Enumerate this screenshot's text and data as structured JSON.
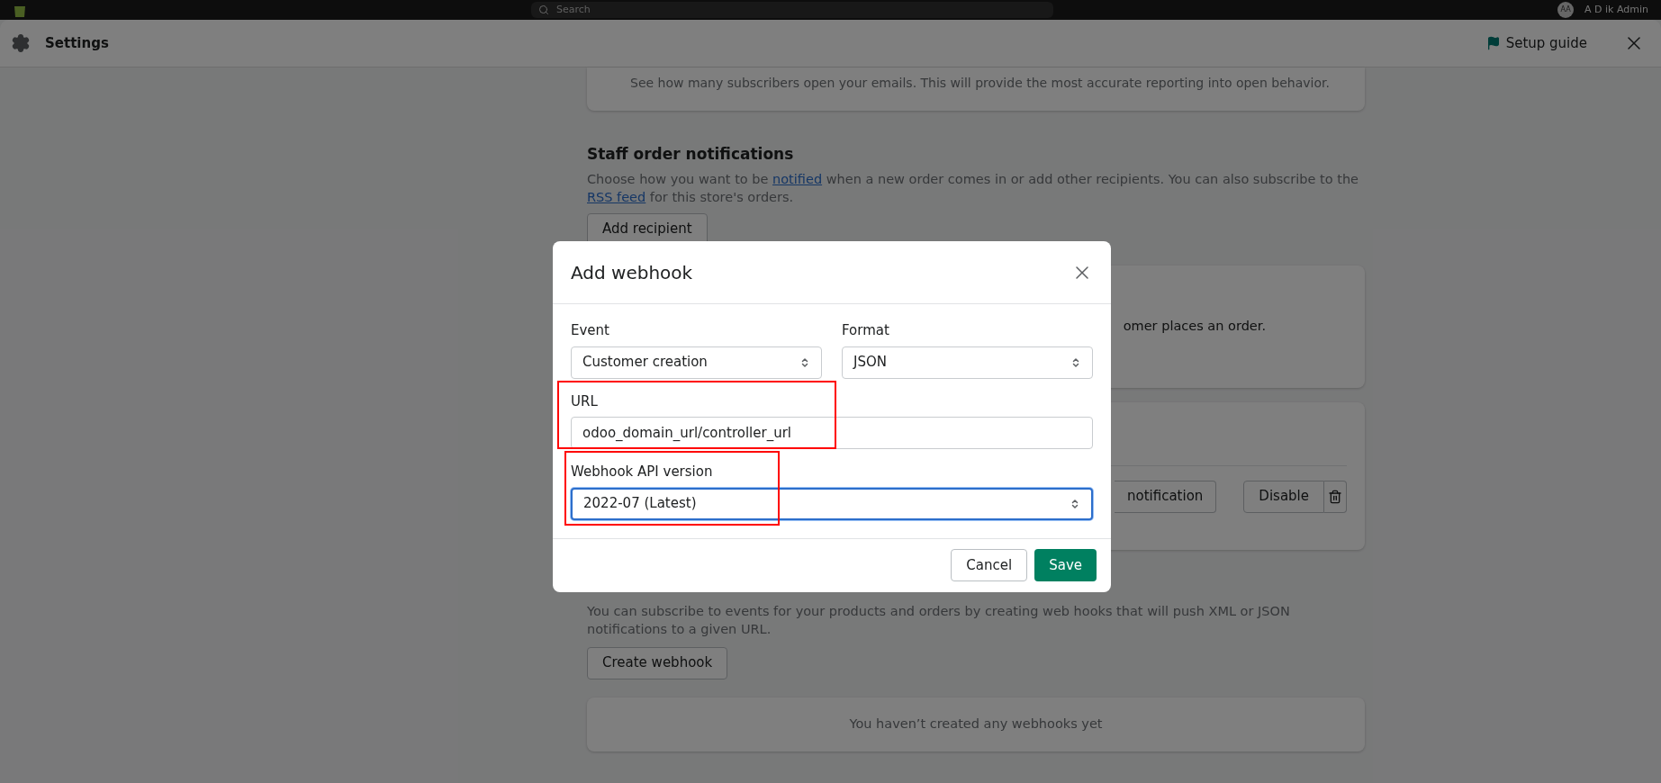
{
  "top_bar": {
    "search": {
      "placeholder": "Search"
    },
    "avatar": "AA",
    "user": "A D ik Admin"
  },
  "header": {
    "title": "Settings",
    "setup_guide": "Setup guide"
  },
  "open_tracking": {
    "description": "See how many subscribers open your emails. This will provide the most accurate reporting into open behavior."
  },
  "staff_notifications": {
    "title": "Staff order notifications",
    "text": [
      {
        "kind": "text",
        "text": "Choose how you want to be "
      },
      {
        "kind": "link",
        "text": "notified"
      },
      {
        "kind": "text",
        "text": " when a new order comes in or add other recipients. You can also subscribe to the "
      },
      {
        "kind": "link",
        "text": "RSS feed"
      },
      {
        "kind": "text",
        "text": " for this store's orders."
      }
    ],
    "button": "Add recipient"
  },
  "order_card": {
    "text": "omer places an order."
  },
  "recipient_card": {
    "buttons": [
      "notification",
      "Disable"
    ]
  },
  "webhooks": {
    "description": "You can subscribe to events for your products and orders by creating web hooks that will push XML or JSON notifications to a given URL.",
    "button": "Create webhook",
    "empty": "You haven’t created any webhooks yet"
  },
  "modal": {
    "title": "Add webhook",
    "fields": [
      {
        "kind": "select",
        "label": "Event",
        "value": "Customer creation",
        "focused": false,
        "highlighted": false
      },
      {
        "kind": "select",
        "label": "Format",
        "value": "JSON",
        "focused": false,
        "highlighted": false
      },
      {
        "kind": "input",
        "label": "URL",
        "value": "odoo_domain_url/controller_url",
        "focused": false,
        "highlighted": true
      },
      {
        "kind": "select",
        "label": "Webhook API version",
        "value": "2022-07 (Latest)",
        "focused": true,
        "highlighted": true
      }
    ],
    "buttons": [
      {
        "label": "Cancel",
        "primary": false
      },
      {
        "label": "Save",
        "primary": true
      }
    ]
  }
}
